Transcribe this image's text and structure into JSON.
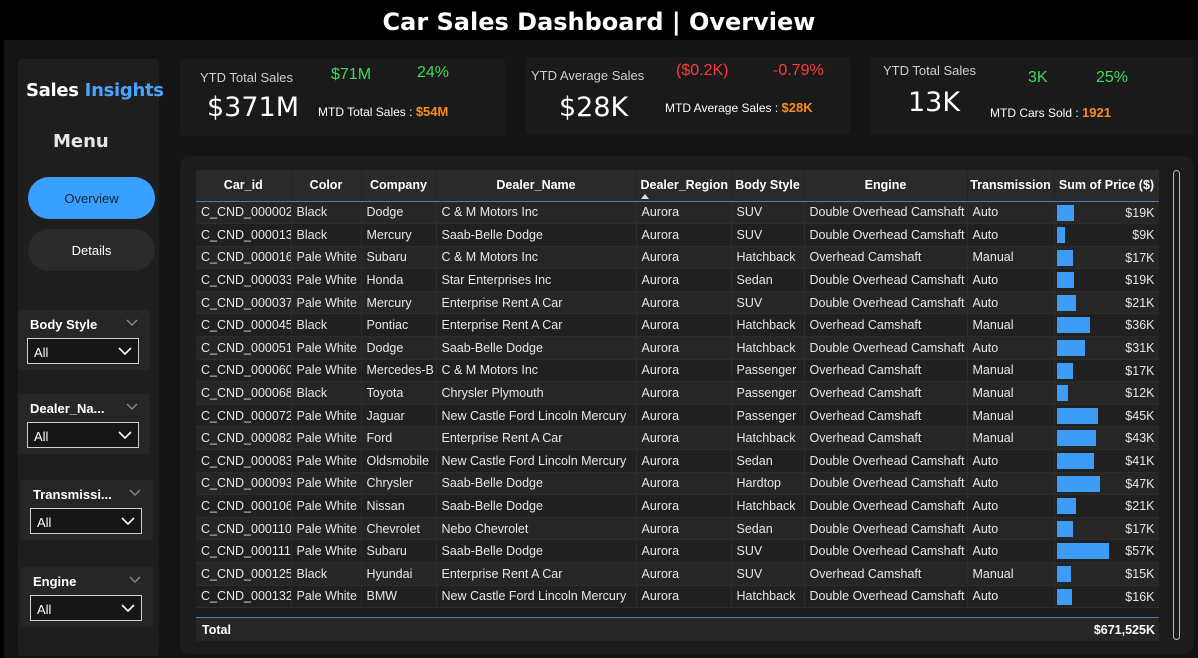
{
  "header": {
    "title": "Car Sales Dashboard | Overview"
  },
  "sidebar": {
    "brand_part1": "Sales",
    "brand_part2": "Insights",
    "menu_title": "Menu",
    "nav": [
      {
        "label": "Overview"
      },
      {
        "label": "Details"
      }
    ],
    "slicers": [
      {
        "label": "Body Style",
        "value": "All"
      },
      {
        "label": "Dealer_Na...",
        "value": "All"
      },
      {
        "label": "Transmissi...",
        "value": "All"
      },
      {
        "label": "Engine",
        "value": "All"
      }
    ]
  },
  "kpis": [
    {
      "label": "YTD Total Sales",
      "value": "$371M",
      "delta_value": "$71M",
      "delta_pct": "24%",
      "sub_label": "MTD Total Sales :",
      "sub_value": "$54M"
    },
    {
      "label": "YTD Average Sales",
      "value": "$28K",
      "delta_value": "($0.2K)",
      "delta_pct": "-0.79%",
      "sub_label": "MTD Average Sales :",
      "sub_value": "$28K"
    },
    {
      "label": "YTD Total Sales",
      "value": "13K",
      "delta_value": "3K",
      "delta_pct": "25%",
      "sub_label": "MTD Cars Sold :",
      "sub_value": "1921"
    }
  ],
  "colors": {
    "accent": "#3aa0ff",
    "positive": "#3ddc5a",
    "negative": "#ff3b3b",
    "highlight": "#ff8c1a",
    "bar": "#3d9cf5"
  },
  "table": {
    "columns": [
      "Car_id",
      "Color",
      "Company",
      "Dealer_Name",
      "Dealer_Region",
      "Body Style",
      "Engine",
      "Transmission",
      "Sum of Price ($)"
    ],
    "rows": [
      [
        "C_CND_000002",
        "Black",
        "Dodge",
        "C & M Motors Inc",
        "Aurora",
        "SUV",
        "Double Overhead Camshaft",
        "Auto",
        "$19K",
        19
      ],
      [
        "C_CND_000013",
        "Black",
        "Mercury",
        "Saab-Belle Dodge",
        "Aurora",
        "SUV",
        "Double Overhead Camshaft",
        "Auto",
        "$9K",
        9
      ],
      [
        "C_CND_000016",
        "Pale White",
        "Subaru",
        "C & M Motors Inc",
        "Aurora",
        "Hatchback",
        "Overhead Camshaft",
        "Manual",
        "$17K",
        17
      ],
      [
        "C_CND_000033",
        "Pale White",
        "Honda",
        "Star Enterprises Inc",
        "Aurora",
        "Sedan",
        "Double Overhead Camshaft",
        "Auto",
        "$19K",
        19
      ],
      [
        "C_CND_000037",
        "Pale White",
        "Mercury",
        "Enterprise Rent A Car",
        "Aurora",
        "SUV",
        "Double Overhead Camshaft",
        "Auto",
        "$21K",
        21
      ],
      [
        "C_CND_000045",
        "Black",
        "Pontiac",
        "Enterprise Rent A Car",
        "Aurora",
        "Hatchback",
        "Overhead Camshaft",
        "Manual",
        "$36K",
        36
      ],
      [
        "C_CND_000051",
        "Pale White",
        "Dodge",
        "Saab-Belle Dodge",
        "Aurora",
        "Hatchback",
        "Double Overhead Camshaft",
        "Auto",
        "$31K",
        31
      ],
      [
        "C_CND_000060",
        "Pale White",
        "Mercedes-B",
        "C & M Motors Inc",
        "Aurora",
        "Passenger",
        "Overhead Camshaft",
        "Manual",
        "$17K",
        17
      ],
      [
        "C_CND_000068",
        "Black",
        "Toyota",
        "Chrysler Plymouth",
        "Aurora",
        "Passenger",
        "Overhead Camshaft",
        "Manual",
        "$12K",
        12
      ],
      [
        "C_CND_000072",
        "Pale White",
        "Jaguar",
        "New Castle Ford Lincoln Mercury",
        "Aurora",
        "Passenger",
        "Overhead Camshaft",
        "Manual",
        "$45K",
        45
      ],
      [
        "C_CND_000082",
        "Pale White",
        "Ford",
        "Enterprise Rent A Car",
        "Aurora",
        "Hatchback",
        "Overhead Camshaft",
        "Manual",
        "$43K",
        43
      ],
      [
        "C_CND_000083",
        "Pale White",
        "Oldsmobile",
        "New Castle Ford Lincoln Mercury",
        "Aurora",
        "Sedan",
        "Double Overhead Camshaft",
        "Auto",
        "$41K",
        41
      ],
      [
        "C_CND_000093",
        "Pale White",
        "Chrysler",
        "Saab-Belle Dodge",
        "Aurora",
        "Hardtop",
        "Double Overhead Camshaft",
        "Auto",
        "$47K",
        47
      ],
      [
        "C_CND_000106",
        "Pale White",
        "Nissan",
        "Saab-Belle Dodge",
        "Aurora",
        "Hatchback",
        "Double Overhead Camshaft",
        "Auto",
        "$21K",
        21
      ],
      [
        "C_CND_000110",
        "Pale White",
        "Chevrolet",
        "Nebo Chevrolet",
        "Aurora",
        "Sedan",
        "Double Overhead Camshaft",
        "Auto",
        "$17K",
        17
      ],
      [
        "C_CND_000111",
        "Pale White",
        "Subaru",
        "Saab-Belle Dodge",
        "Aurora",
        "SUV",
        "Double Overhead Camshaft",
        "Auto",
        "$57K",
        57
      ],
      [
        "C_CND_000125",
        "Black",
        "Hyundai",
        "Enterprise Rent A Car",
        "Aurora",
        "SUV",
        "Overhead Camshaft",
        "Manual",
        "$15K",
        15
      ],
      [
        "C_CND_000132",
        "Pale White",
        "BMW",
        "New Castle Ford Lincoln Mercury",
        "Aurora",
        "Hatchback",
        "Double Overhead Camshaft",
        "Auto",
        "$16K",
        16
      ]
    ],
    "bar_max": 57,
    "total_label": "Total",
    "total_value": "$671,525K"
  }
}
